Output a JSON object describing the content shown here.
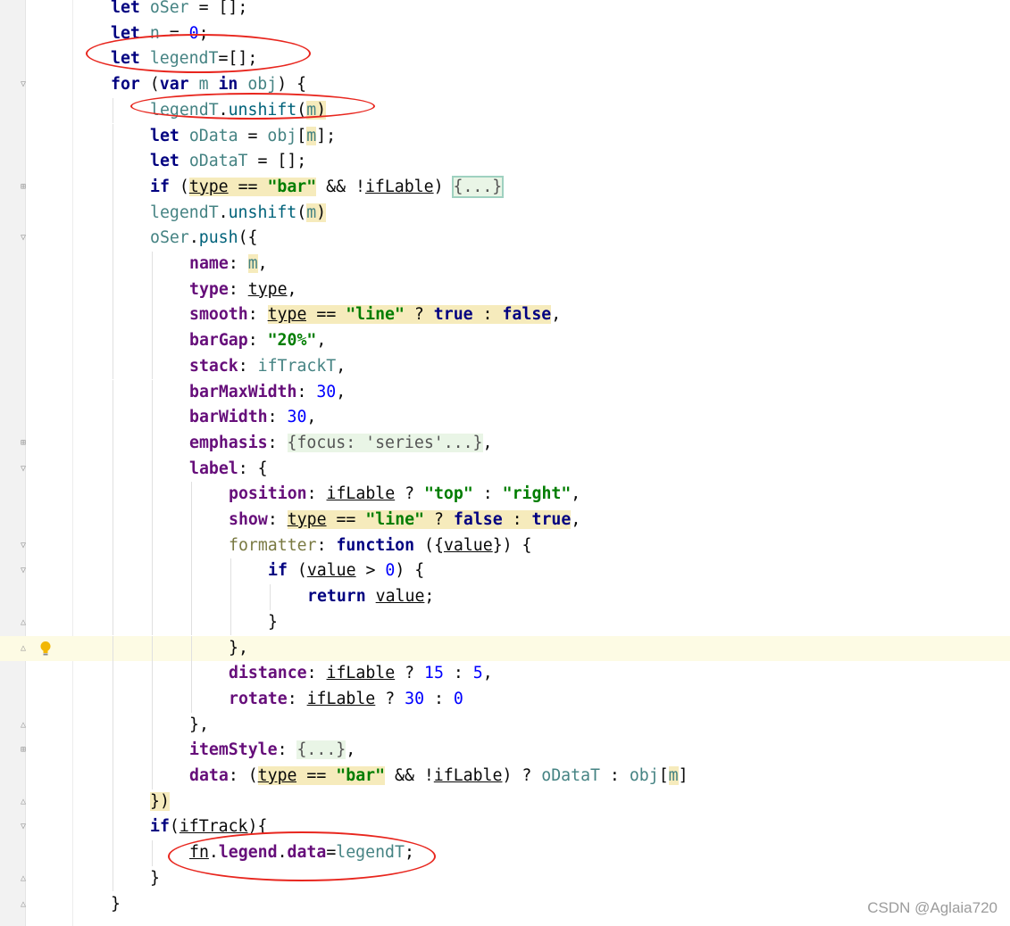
{
  "editor": {
    "lines": [
      {
        "indent": 1,
        "tokens": [
          [
            "kw",
            "let"
          ],
          [
            "id",
            " "
          ],
          [
            "var",
            "oSer"
          ],
          [
            "pun",
            " = [];"
          ]
        ]
      },
      {
        "indent": 1,
        "tokens": [
          [
            "kw",
            "let"
          ],
          [
            "id",
            " "
          ],
          [
            "var",
            "n"
          ],
          [
            "pun",
            " = "
          ],
          [
            "num",
            "0"
          ],
          [
            "pun",
            ";"
          ]
        ]
      },
      {
        "indent": 1,
        "tokens": [
          [
            "kw",
            "let"
          ],
          [
            "id",
            " "
          ],
          [
            "var",
            "legendT"
          ],
          [
            "pun",
            "=[];"
          ]
        ]
      },
      {
        "indent": 1,
        "tokens": [
          [
            "kw",
            "for"
          ],
          [
            "pun",
            " ("
          ],
          [
            "kw",
            "var"
          ],
          [
            "id",
            " "
          ],
          [
            "var",
            "m"
          ],
          [
            "id",
            " "
          ],
          [
            "kw",
            "in"
          ],
          [
            "id",
            " "
          ],
          [
            "var",
            "obj"
          ],
          [
            "pun",
            ") {"
          ]
        ]
      },
      {
        "indent": 2,
        "tokens": [
          [
            "var",
            "legendT"
          ],
          [
            "pun",
            "."
          ],
          [
            "fn",
            "unshift"
          ],
          [
            "pun",
            "("
          ],
          [
            "var",
            "m",
            1
          ],
          [
            "pun",
            ")",
            1
          ]
        ]
      },
      {
        "indent": 2,
        "tokens": [
          [
            "kw",
            "let"
          ],
          [
            "id",
            " "
          ],
          [
            "var",
            "oData"
          ],
          [
            "pun",
            " = "
          ],
          [
            "var",
            "obj"
          ],
          [
            "pun",
            "["
          ],
          [
            "var",
            "m",
            1
          ],
          [
            "pun",
            "];"
          ]
        ]
      },
      {
        "indent": 2,
        "tokens": [
          [
            "kw",
            "let"
          ],
          [
            "id",
            " "
          ],
          [
            "var",
            "oDataT"
          ],
          [
            "pun",
            " = [];"
          ]
        ]
      },
      {
        "indent": 2,
        "tokens": [
          [
            "kw",
            "if"
          ],
          [
            "pun",
            " ("
          ],
          [
            "ul",
            "type",
            1
          ],
          [
            "pun",
            " == ",
            1
          ],
          [
            "str",
            "\"bar\"",
            1
          ],
          [
            "pun",
            " && !"
          ],
          [
            "ul",
            "ifLable"
          ],
          [
            "pun",
            ") "
          ],
          [
            "fold2",
            "{...}"
          ]
        ]
      },
      {
        "indent": 2,
        "tokens": [
          [
            "var",
            "legendT"
          ],
          [
            "pun",
            "."
          ],
          [
            "fn",
            "unshift"
          ],
          [
            "pun",
            "("
          ],
          [
            "var",
            "m",
            1
          ],
          [
            "pun",
            ")",
            1
          ]
        ]
      },
      {
        "indent": 2,
        "tokens": [
          [
            "var",
            "oSer"
          ],
          [
            "pun",
            "."
          ],
          [
            "fn",
            "push"
          ],
          [
            "pun",
            "({"
          ]
        ]
      },
      {
        "indent": 3,
        "tokens": [
          [
            "prop",
            "name"
          ],
          [
            "pun",
            ": "
          ],
          [
            "var",
            "m",
            1
          ],
          [
            "pun",
            ","
          ]
        ]
      },
      {
        "indent": 3,
        "tokens": [
          [
            "prop",
            "type"
          ],
          [
            "pun",
            ": "
          ],
          [
            "ul",
            "type"
          ],
          [
            "pun",
            ","
          ]
        ]
      },
      {
        "indent": 3,
        "tokens": [
          [
            "prop",
            "smooth"
          ],
          [
            "pun",
            ": "
          ],
          [
            "ul",
            "type",
            1
          ],
          [
            "pun",
            " == ",
            1
          ],
          [
            "str",
            "\"line\"",
            1
          ],
          [
            "pun",
            " ? ",
            1
          ],
          [
            "kw",
            "true",
            1
          ],
          [
            "pun",
            " : ",
            1
          ],
          [
            "kw",
            "false",
            1
          ],
          [
            "pun",
            ","
          ]
        ]
      },
      {
        "indent": 3,
        "tokens": [
          [
            "prop",
            "barGap"
          ],
          [
            "pun",
            ": "
          ],
          [
            "str",
            "\"20%\""
          ],
          [
            "pun",
            ","
          ]
        ]
      },
      {
        "indent": 3,
        "tokens": [
          [
            "prop",
            "stack"
          ],
          [
            "pun",
            ": "
          ],
          [
            "var",
            "ifTrackT"
          ],
          [
            "pun",
            ","
          ]
        ]
      },
      {
        "indent": 3,
        "tokens": [
          [
            "prop",
            "barMaxWidth"
          ],
          [
            "pun",
            ": "
          ],
          [
            "num",
            "30"
          ],
          [
            "pun",
            ","
          ]
        ]
      },
      {
        "indent": 3,
        "tokens": [
          [
            "prop",
            "barWidth"
          ],
          [
            "pun",
            ": "
          ],
          [
            "num",
            "30"
          ],
          [
            "pun",
            ","
          ]
        ]
      },
      {
        "indent": 3,
        "tokens": [
          [
            "prop",
            "emphasis"
          ],
          [
            "pun",
            ": "
          ],
          [
            "fold",
            "{focus: 'series'...}"
          ],
          [
            "pun",
            ","
          ]
        ]
      },
      {
        "indent": 3,
        "tokens": [
          [
            "prop",
            "label"
          ],
          [
            "pun",
            ": {"
          ]
        ]
      },
      {
        "indent": 4,
        "tokens": [
          [
            "prop",
            "position"
          ],
          [
            "pun",
            ": "
          ],
          [
            "ul",
            "ifLable"
          ],
          [
            "pun",
            " ? "
          ],
          [
            "str",
            "\"top\""
          ],
          [
            "pun",
            " : "
          ],
          [
            "str",
            "\"right\""
          ],
          [
            "pun",
            ","
          ]
        ]
      },
      {
        "indent": 4,
        "tokens": [
          [
            "prop",
            "show"
          ],
          [
            "pun",
            ": "
          ],
          [
            "ul",
            "type",
            1
          ],
          [
            "pun",
            " == ",
            1
          ],
          [
            "str",
            "\"line\"",
            1
          ],
          [
            "pun",
            " ? ",
            1
          ],
          [
            "kw",
            "false",
            1
          ],
          [
            "pun",
            " : ",
            1
          ],
          [
            "kw",
            "true",
            1
          ],
          [
            "pun",
            ","
          ]
        ]
      },
      {
        "indent": 4,
        "tokens": [
          [
            "gray",
            "formatter"
          ],
          [
            "pun",
            ": "
          ],
          [
            "kw",
            "function"
          ],
          [
            "pun",
            " ({"
          ],
          [
            "ul",
            "value"
          ],
          [
            "pun",
            "}) {"
          ]
        ]
      },
      {
        "indent": 5,
        "tokens": [
          [
            "kw",
            "if"
          ],
          [
            "pun",
            " ("
          ],
          [
            "ul",
            "value"
          ],
          [
            "pun",
            " > "
          ],
          [
            "num",
            "0"
          ],
          [
            "pun",
            ") {"
          ]
        ]
      },
      {
        "indent": 6,
        "tokens": [
          [
            "kw",
            "return"
          ],
          [
            "id",
            " "
          ],
          [
            "ul",
            "value"
          ],
          [
            "pun",
            ";"
          ]
        ]
      },
      {
        "indent": 5,
        "tokens": [
          [
            "pun",
            "}"
          ]
        ]
      },
      {
        "indent": 4,
        "hl": true,
        "tokens": [
          [
            "pun",
            "},"
          ]
        ]
      },
      {
        "indent": 4,
        "tokens": [
          [
            "prop",
            "distance"
          ],
          [
            "pun",
            ": "
          ],
          [
            "ul",
            "ifLable"
          ],
          [
            "pun",
            " ? "
          ],
          [
            "num",
            "15"
          ],
          [
            "pun",
            " : "
          ],
          [
            "num",
            "5"
          ],
          [
            "pun",
            ","
          ]
        ]
      },
      {
        "indent": 4,
        "tokens": [
          [
            "prop",
            "rotate"
          ],
          [
            "pun",
            ": "
          ],
          [
            "ul",
            "ifLable"
          ],
          [
            "pun",
            " ? "
          ],
          [
            "num",
            "30"
          ],
          [
            "pun",
            " : "
          ],
          [
            "num",
            "0"
          ]
        ]
      },
      {
        "indent": 3,
        "tokens": [
          [
            "pun",
            "},"
          ]
        ]
      },
      {
        "indent": 3,
        "tokens": [
          [
            "prop",
            "itemStyle"
          ],
          [
            "pun",
            ": "
          ],
          [
            "fold",
            "{...}"
          ],
          [
            "pun",
            ","
          ]
        ]
      },
      {
        "indent": 3,
        "tokens": [
          [
            "prop",
            "data"
          ],
          [
            "pun",
            ": ("
          ],
          [
            "ul",
            "type",
            1
          ],
          [
            "pun",
            " == ",
            1
          ],
          [
            "str",
            "\"bar\"",
            1
          ],
          [
            "pun",
            " && !"
          ],
          [
            "ul",
            "ifLable"
          ],
          [
            "pun",
            ") ? "
          ],
          [
            "var",
            "oDataT"
          ],
          [
            "pun",
            " : "
          ],
          [
            "var",
            "obj"
          ],
          [
            "pun",
            "["
          ],
          [
            "var",
            "m",
            1
          ],
          [
            "pun",
            "]"
          ]
        ]
      },
      {
        "indent": 2,
        "tokens": [
          [
            "pun",
            "})",
            1
          ]
        ]
      },
      {
        "indent": 2,
        "tokens": [
          [
            "kw",
            "if"
          ],
          [
            "pun",
            "("
          ],
          [
            "ul",
            "ifTrack"
          ],
          [
            "pun",
            "){"
          ]
        ]
      },
      {
        "indent": 3,
        "tokens": [
          [
            "ul",
            "fn"
          ],
          [
            "pun",
            "."
          ],
          [
            "prop",
            "legend"
          ],
          [
            "pun",
            "."
          ],
          [
            "prop",
            "data"
          ],
          [
            "pun",
            "="
          ],
          [
            "var",
            "legendT"
          ],
          [
            "pun",
            ";"
          ]
        ]
      },
      {
        "indent": 2,
        "tokens": [
          [
            "pun",
            "}"
          ]
        ]
      },
      {
        "indent": 1,
        "tokens": [
          [
            "pun",
            "}"
          ]
        ]
      }
    ]
  },
  "gutter_icons": [
    {
      "line": 3,
      "icon": "fold-collapse-icon"
    },
    {
      "line": 7,
      "icon": "fold-expand-icon"
    },
    {
      "line": 9,
      "icon": "fold-collapse-icon"
    },
    {
      "line": 17,
      "icon": "fold-expand-icon"
    },
    {
      "line": 18,
      "icon": "fold-collapse-icon"
    },
    {
      "line": 21,
      "icon": "fold-collapse-icon"
    },
    {
      "line": 22,
      "icon": "fold-collapse-icon"
    },
    {
      "line": 24,
      "icon": "fold-end-icon"
    },
    {
      "line": 25,
      "icon": "fold-end-icon"
    },
    {
      "line": 28,
      "icon": "fold-end-icon"
    },
    {
      "line": 29,
      "icon": "fold-expand-icon"
    },
    {
      "line": 31,
      "icon": "fold-end-icon"
    },
    {
      "line": 32,
      "icon": "fold-collapse-icon"
    },
    {
      "line": 34,
      "icon": "fold-end-icon"
    },
    {
      "line": 35,
      "icon": "fold-end-icon"
    }
  ],
  "intention_bulb": {
    "line": 25,
    "icon": "lightbulb-icon"
  },
  "annotations": [
    "red-ellipse",
    "red-ellipse",
    "red-ellipse"
  ],
  "watermark": "CSDN @Aglaia720",
  "colors": {
    "keyword": "#000080",
    "property": "#660e7a",
    "variable": "#458383",
    "string": "#007d00",
    "number": "#0000ff",
    "function": "#00627a",
    "highlight": "#f6ebbc",
    "annotation": "#e8261e"
  }
}
